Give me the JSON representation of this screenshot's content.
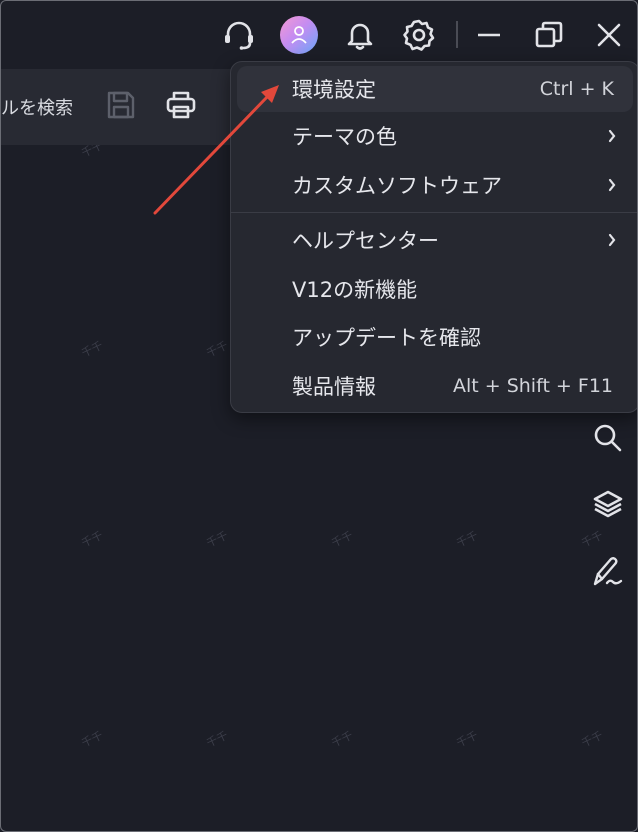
{
  "titlebar": {
    "icons": [
      "headset-icon",
      "avatar",
      "bell-icon",
      "gear-icon",
      "minimize-icon",
      "restore-icon",
      "close-icon"
    ]
  },
  "toolbar": {
    "search_label": "ルを検索",
    "buttons": [
      "save-icon",
      "print-icon"
    ]
  },
  "menu": {
    "items": [
      {
        "label": "環境設定",
        "shortcut": "Ctrl + K",
        "submenu": false
      },
      {
        "label": "テーマの色",
        "shortcut": "",
        "submenu": true
      },
      {
        "label": "カスタムソフトウェア",
        "shortcut": "",
        "submenu": true
      },
      {
        "label": "ヘルプセンター",
        "shortcut": "",
        "submenu": true
      },
      {
        "label": "V12の新機能",
        "shortcut": "",
        "submenu": false
      },
      {
        "label": "アップデートを確認",
        "shortcut": "",
        "submenu": false
      },
      {
        "label": "製品情報",
        "shortcut": "Alt + Shift + F11",
        "submenu": false
      }
    ]
  },
  "sidebar_tools": [
    "search-icon",
    "layers-icon",
    "signature-icon"
  ],
  "watermark": "千千",
  "colors": {
    "background": "#1c1e27",
    "menu_bg": "#262830",
    "menu_hover": "#30323b",
    "arrow": "#e2483b",
    "text": "#e6e7ec"
  }
}
